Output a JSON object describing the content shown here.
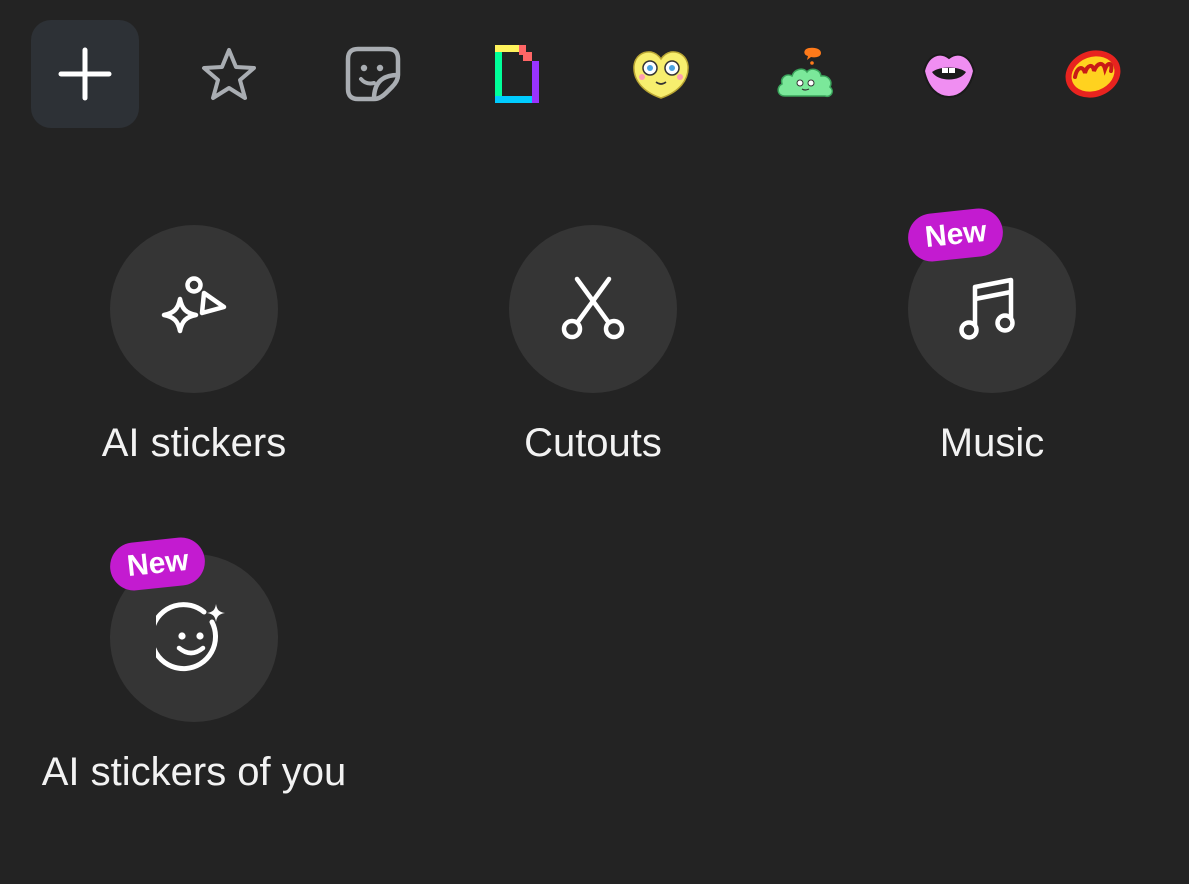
{
  "tabs": [
    {
      "name": "add",
      "icon": "plus-icon"
    },
    {
      "name": "favorites",
      "icon": "star-icon"
    },
    {
      "name": "stickers",
      "icon": "sticker-face-icon"
    },
    {
      "name": "giphy",
      "icon": "giphy-logo-icon"
    },
    {
      "name": "sticker-pack-heart",
      "icon": "yellow-heart-sticker-icon"
    },
    {
      "name": "sticker-pack-cloud",
      "icon": "green-cloud-sticker-icon"
    },
    {
      "name": "sticker-pack-lips",
      "icon": "pink-lips-sticker-icon"
    },
    {
      "name": "sticker-pack-wow",
      "icon": "wow-sticker-icon"
    }
  ],
  "grid": {
    "ai_stickers": {
      "label": "AI stickers",
      "icon": "sparkle-shapes-icon"
    },
    "cutouts": {
      "label": "Cutouts",
      "icon": "scissors-icon"
    },
    "music": {
      "label": "Music",
      "icon": "music-note-icon",
      "badge": "New"
    },
    "ai_stickers_of_you": {
      "label": "AI stickers of you",
      "icon": "smiley-sparkle-icon",
      "badge": "New"
    }
  },
  "colors": {
    "background": "#232323",
    "circle": "#353535",
    "badge": "#c31bd0",
    "active_tab": "#2d3136"
  }
}
